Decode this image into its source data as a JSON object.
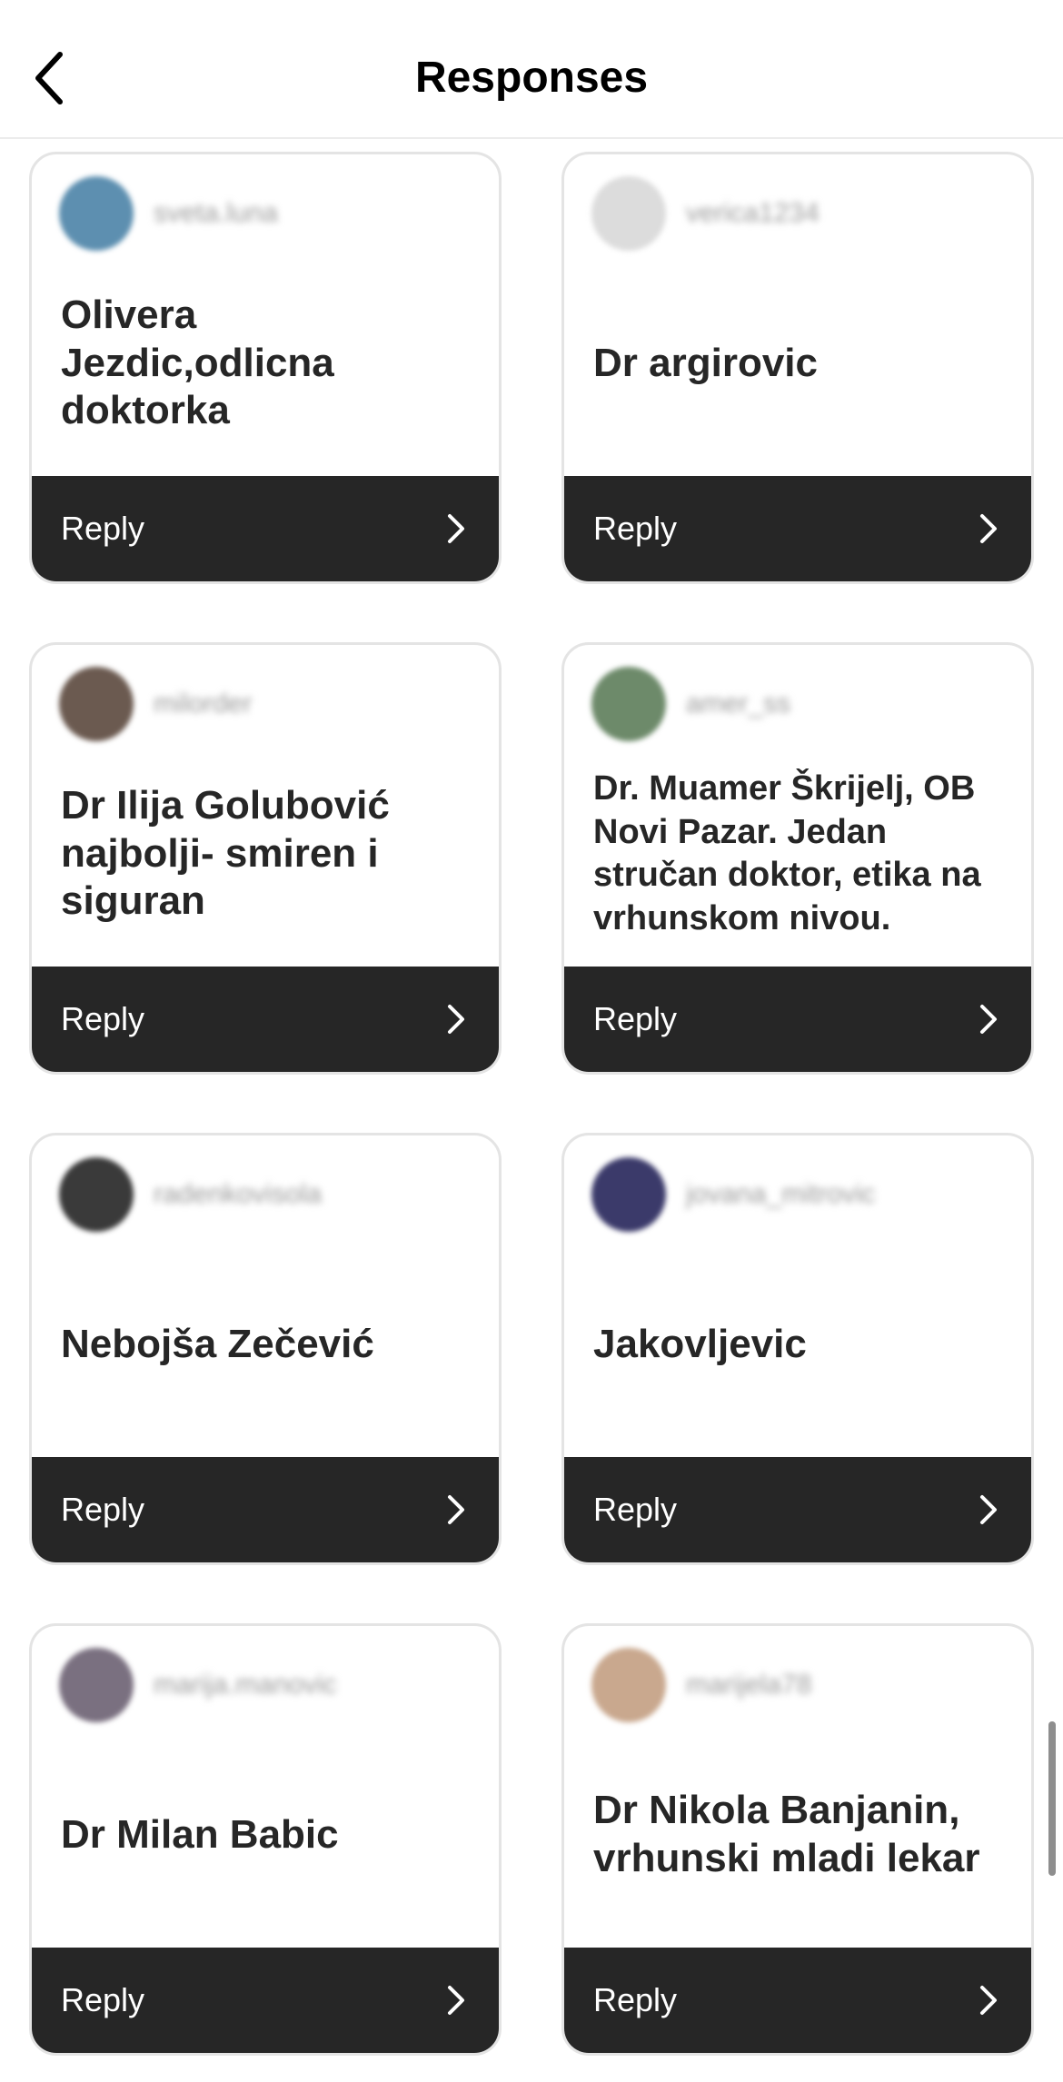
{
  "header": {
    "title": "Responses"
  },
  "cards": [
    {
      "username": "sveta.luna",
      "answer": "Olivera Jezdic,odlicna doktorka",
      "reply": "Reply",
      "avatar_color": "#5d8fb0"
    },
    {
      "username": "verica1234",
      "answer": "Dr argirovic",
      "reply": "Reply",
      "avatar_color": "#dcdcdc"
    },
    {
      "username": "milorder",
      "answer": "Dr Ilija Golubović najbolji- smiren i siguran",
      "reply": "Reply",
      "avatar_color": "#6b5a50"
    },
    {
      "username": "amer_ss",
      "answer": "Dr. Muamer Škrijelj, OB Novi Pazar. Jedan stručan doktor, etika na vrhunskom nivou.",
      "reply": "Reply",
      "avatar_color": "#6d8a6a"
    },
    {
      "username": "radenkovisola",
      "answer": "Nebojša Zečević",
      "reply": "Reply",
      "avatar_color": "#3a3a3a"
    },
    {
      "username": "jovana_mitrovic",
      "answer": "Jakovljevic",
      "reply": "Reply",
      "avatar_color": "#3b3a6a"
    },
    {
      "username": "marija.manovic",
      "answer": "Dr Milan Babic",
      "reply": "Reply",
      "avatar_color": "#7a7080"
    },
    {
      "username": "marijela78",
      "answer": "Dr Nikola Banjanin, vrhunski mladi lekar",
      "reply": "Reply",
      "avatar_color": "#c9a88e"
    }
  ]
}
